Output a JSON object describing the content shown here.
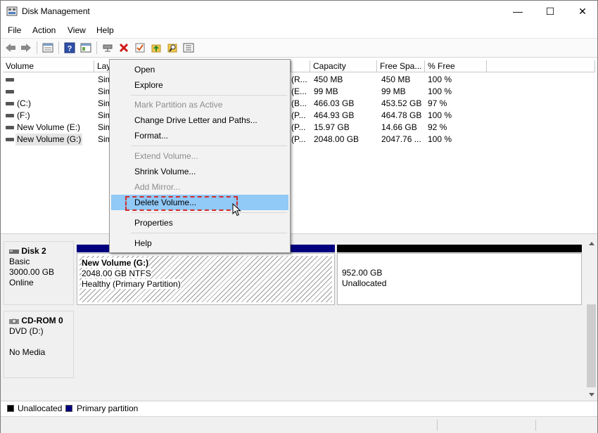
{
  "window": {
    "title": "Disk Management",
    "minimize_glyph": "—",
    "maximize_glyph": "☐",
    "close_glyph": "✕"
  },
  "menu": [
    "File",
    "Action",
    "View",
    "Help"
  ],
  "toolbar_icons": [
    "back-icon",
    "forward-icon",
    "properties-list-icon",
    "help-icon",
    "details-icon",
    "connect-icon",
    "delete-icon",
    "check-icon",
    "folder-up-icon",
    "search-icon",
    "settings-icon"
  ],
  "columns": [
    "Volume",
    "Lay",
    "",
    "Capacity",
    "Free Spa...",
    "% Free"
  ],
  "volumes": [
    {
      "name": "",
      "layout": "Sim",
      "fs": "(R...",
      "capacity": "450 MB",
      "free": "450 MB",
      "pct": "100 %"
    },
    {
      "name": "",
      "layout": "Sim",
      "fs": "(E...",
      "capacity": "99 MB",
      "free": "99 MB",
      "pct": "100 %"
    },
    {
      "name": "(C:)",
      "layout": "Sim",
      "fs": "(B...",
      "capacity": "466.03 GB",
      "free": "453.52 GB",
      "pct": "97 %"
    },
    {
      "name": "(F:)",
      "layout": "Sim",
      "fs": "(P...",
      "capacity": "464.93 GB",
      "free": "464.78 GB",
      "pct": "100 %"
    },
    {
      "name": "New Volume (E:)",
      "layout": "Sim",
      "fs": "(P...",
      "capacity": "15.97 GB",
      "free": "14.66 GB",
      "pct": "92 %"
    },
    {
      "name": "New Volume (G:)",
      "layout": "Sim",
      "fs": "(P...",
      "capacity": "2048.00 GB",
      "free": "2047.76 ...",
      "pct": "100 %"
    }
  ],
  "context_menu": {
    "open": "Open",
    "explore": "Explore",
    "mark_active": "Mark Partition as Active",
    "change_letter": "Change Drive Letter and Paths...",
    "format": "Format...",
    "extend": "Extend Volume...",
    "shrink": "Shrink Volume...",
    "add_mirror": "Add Mirror...",
    "delete": "Delete Volume...",
    "properties": "Properties",
    "help": "Help"
  },
  "disks": {
    "disk2": {
      "name": "Disk 2",
      "type": "Basic",
      "size": "3000.00 GB",
      "status": "Online",
      "partition1": {
        "name": "New Volume  (G:)",
        "size_fs": "2048.00 GB NTFS",
        "status": "Healthy (Primary Partition)"
      },
      "partition2": {
        "size": "952.00 GB",
        "status": "Unallocated"
      }
    },
    "cdrom0": {
      "name": "CD-ROM 0",
      "type": "DVD (D:)",
      "status": "No Media"
    }
  },
  "legend": {
    "unallocated": "Unallocated",
    "primary": "Primary partition"
  },
  "colors": {
    "primary_partition": "#00007f",
    "unallocated": "#000000",
    "highlight": "#91c9f7",
    "dashed_outline": "#d12a2a"
  }
}
